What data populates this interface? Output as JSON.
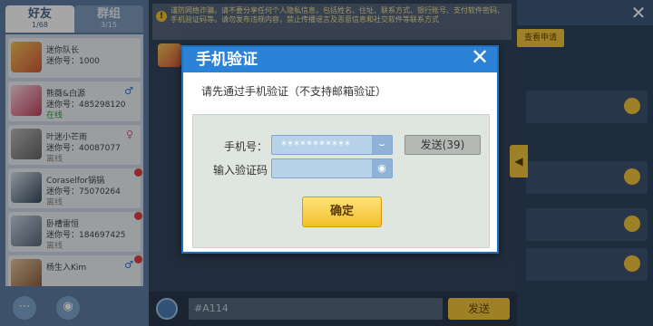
{
  "left_panel": {
    "tabs": [
      {
        "label": "好友",
        "count": "1/68"
      },
      {
        "label": "群组",
        "count": "3/15"
      }
    ],
    "friends": [
      {
        "name": "迷你队长",
        "id_text": "迷你号：1000",
        "status": "",
        "gender": "",
        "has_dot": false
      },
      {
        "name": "熊薇&白源",
        "id_text": "迷你号：485298120",
        "status": "在线",
        "gender": "♂",
        "has_dot": false
      },
      {
        "name": "叶迷小芒雨",
        "id_text": "迷你号：40087077",
        "status": "离线",
        "gender": "♀",
        "has_dot": false
      },
      {
        "name": "Coraselfor锅锅",
        "id_text": "迷你号：75070264",
        "status": "离线",
        "gender": "",
        "has_dot": true
      },
      {
        "name": "卧槽雷恒",
        "id_text": "迷你号：184697425",
        "status": "离线",
        "gender": "",
        "has_dot": true
      },
      {
        "name": "杨生入Kim",
        "id_text": "",
        "status": "",
        "gender": "♂",
        "has_dot": true
      }
    ],
    "bottom_icons": [
      "more-icon",
      "eye-icon"
    ]
  },
  "chat": {
    "notice_text": "谨防网络诈骗，请不要分享任何个人隐私信息，包括姓名、住址、联系方式、银行账号、支付软件密码、手机验证码等。请勿发布违规内容，禁止传播谣言及恶意信息和社交软件等联系方式",
    "input_value": "#A114",
    "send_label": "发送"
  },
  "right_panel": {
    "apply_label": "查看申请"
  },
  "modal": {
    "title": "手机验证",
    "hint": "请先通过手机验证（不支持邮箱验证）",
    "phone_label": "手机号：",
    "phone_value": "***********",
    "code_label": "输入验证码",
    "code_value": "",
    "send_code_label": "发送(39)",
    "confirm_label": "确定"
  },
  "colors": {
    "modal_header": "#2b82d6",
    "confirm_button": "#f4bf2a",
    "field_background": "#b8d2ea",
    "disabled_button": "#b5b9b5"
  }
}
